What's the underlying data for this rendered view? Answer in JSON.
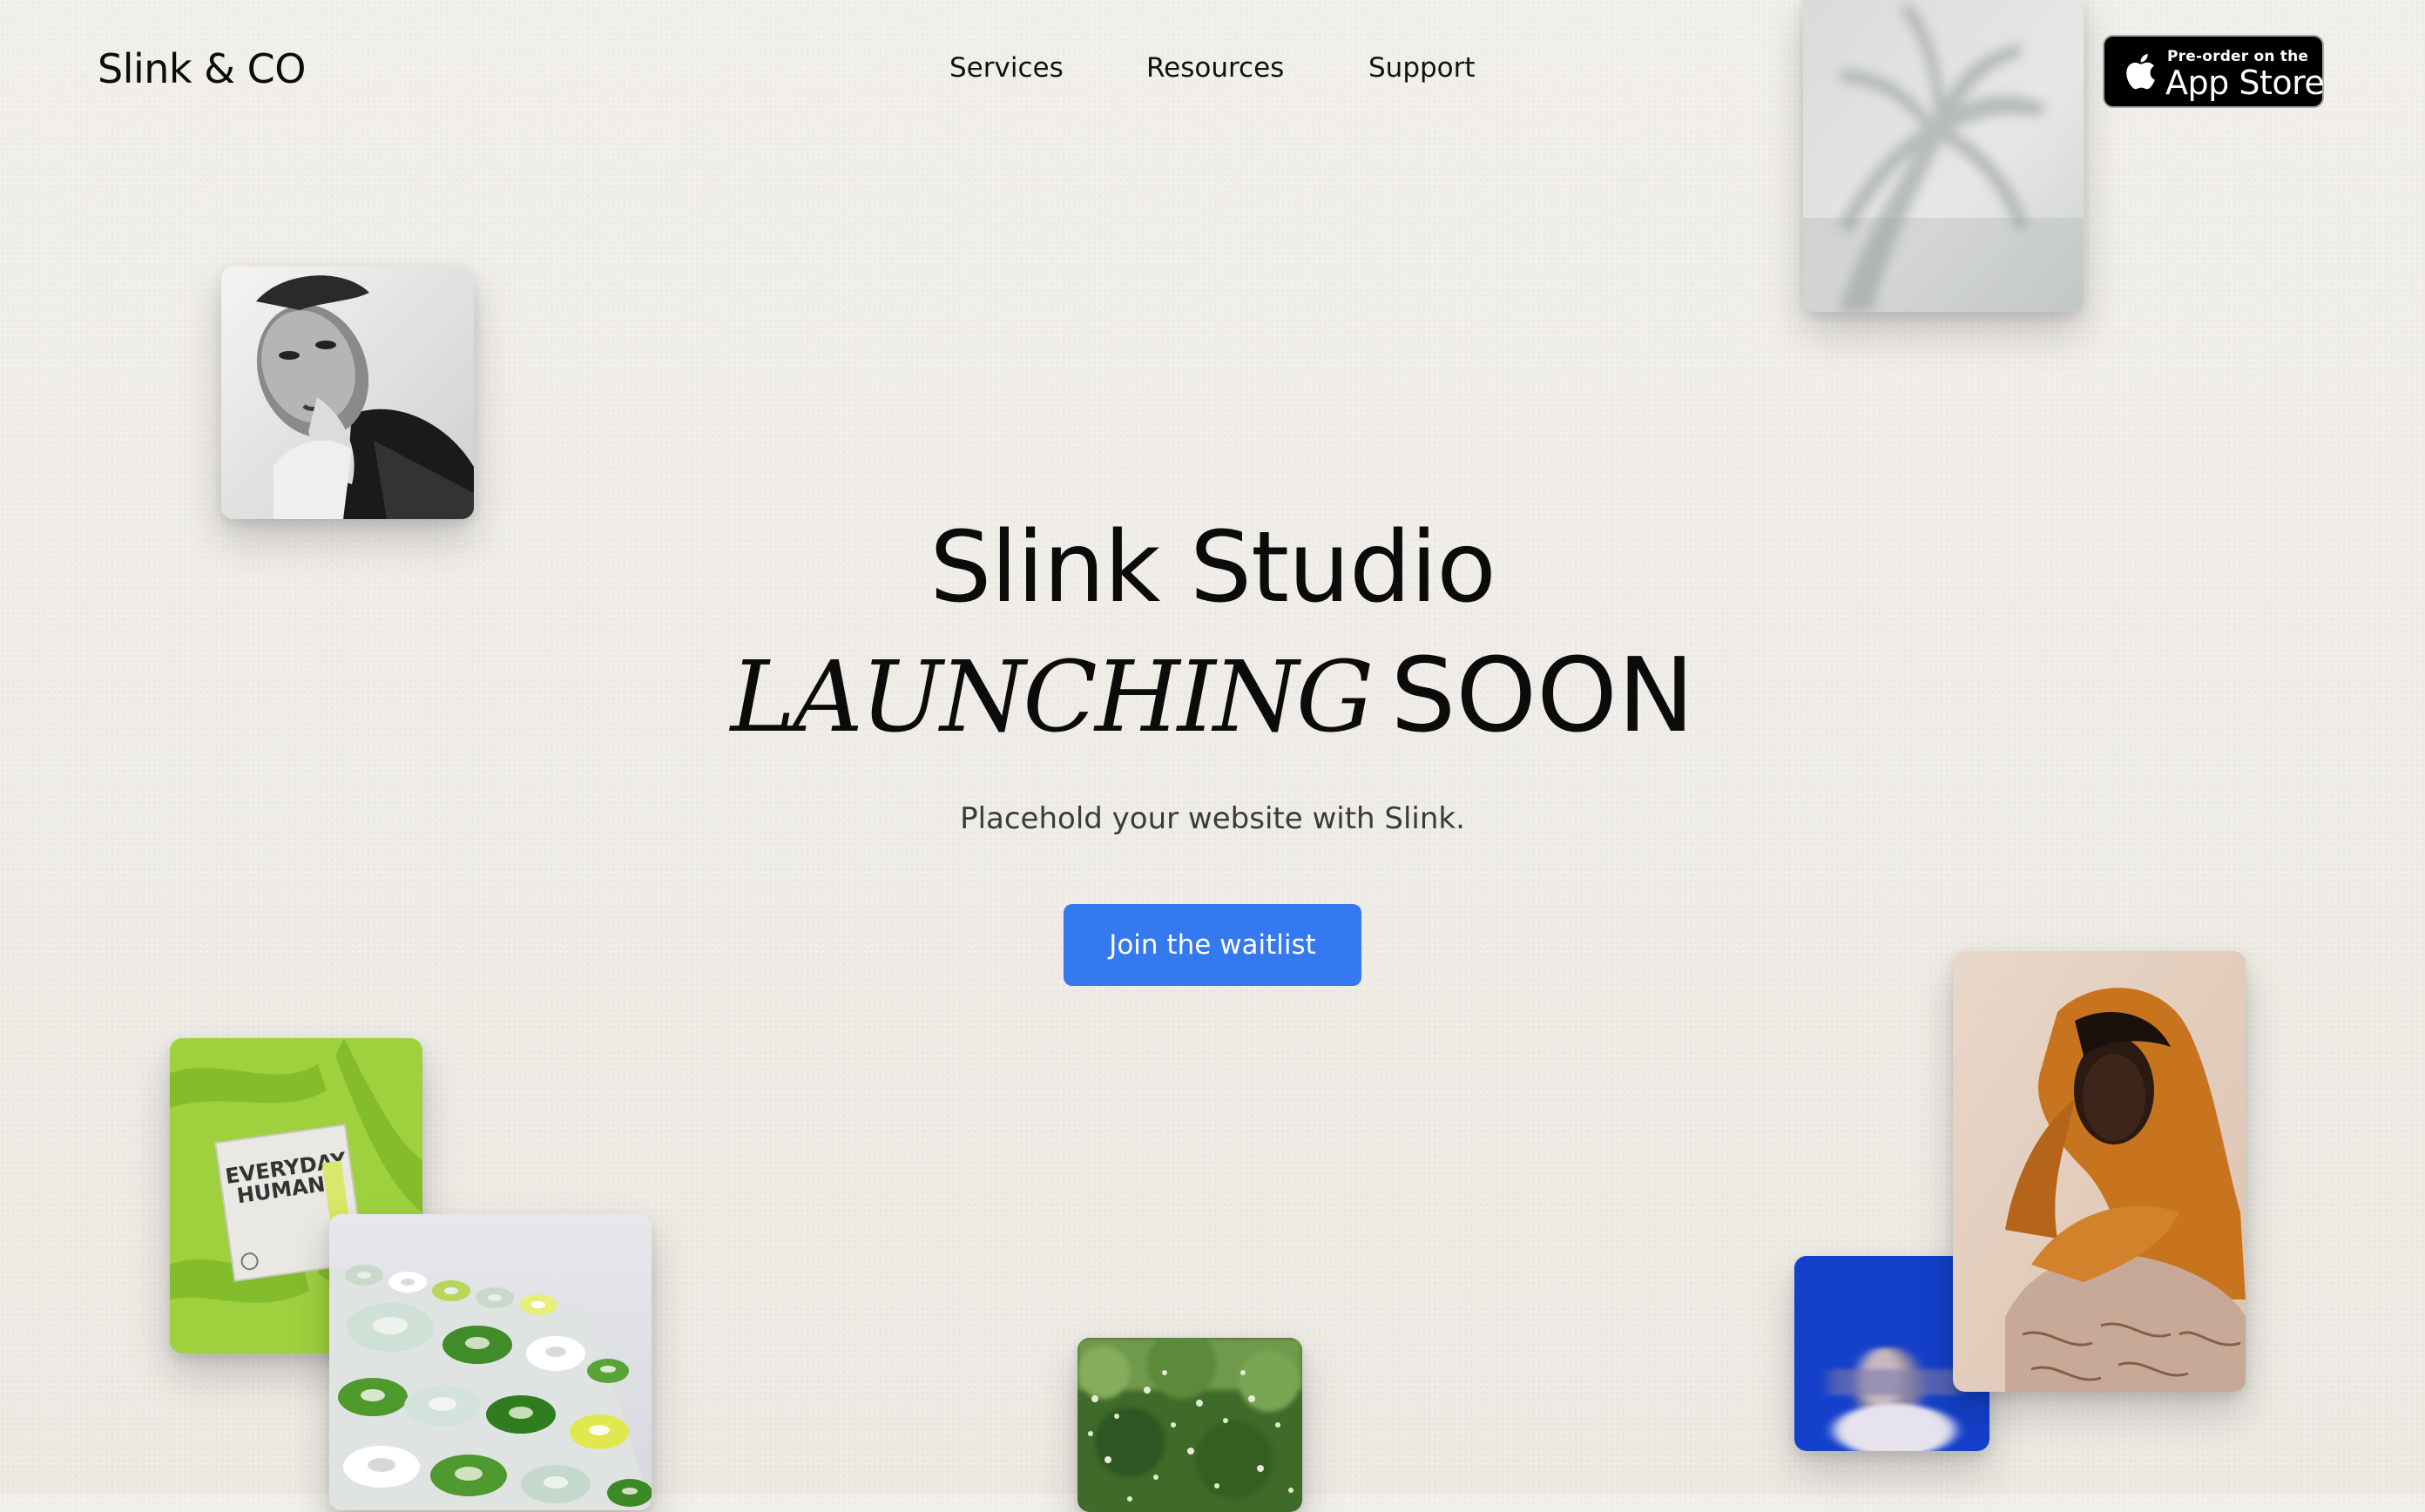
{
  "header": {
    "brand": "Slink & CO",
    "nav": [
      {
        "label": "Services"
      },
      {
        "label": "Resources"
      },
      {
        "label": "Support"
      }
    ],
    "app_store": {
      "small_text": "Pre-order on the",
      "big_text": "App Store"
    }
  },
  "hero": {
    "title": "Slink Studio",
    "launching": "LAUNCHING",
    "soon": "SOON",
    "subtitle": "Placehold your website with Slink.",
    "cta_label": "Join the waitlist"
  },
  "cards": {
    "everyday_text_1": "EVERYDAY",
    "everyday_text_2": "HUMANS"
  },
  "colors": {
    "background": "#efece6",
    "cta": "#3479f0",
    "text": "#0b0b0b"
  }
}
